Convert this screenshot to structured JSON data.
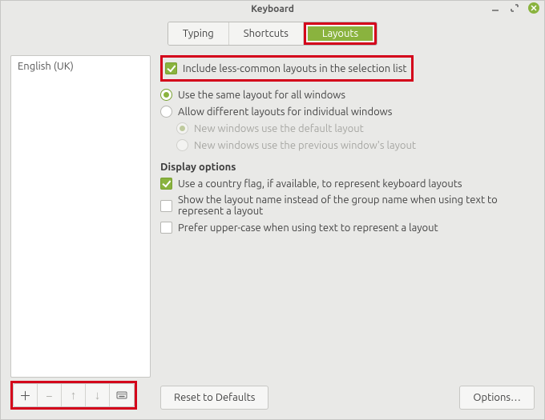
{
  "window": {
    "title": "Keyboard"
  },
  "tabs": {
    "typing": "Typing",
    "shortcuts": "Shortcuts",
    "layouts": "Layouts",
    "active": "layouts"
  },
  "layout_list": {
    "items": [
      "English (UK)"
    ]
  },
  "options": {
    "include_less_common": "Include less-common layouts in the selection list",
    "same_layout_all": "Use the same layout for all windows",
    "different_per_window": "Allow different layouts for individual windows",
    "new_default": "New windows use the default layout",
    "new_previous": "New windows use the previous window's layout"
  },
  "display": {
    "title": "Display options",
    "country_flag": "Use a country flag, if available,  to represent keyboard layouts",
    "layout_name": "Show the layout name instead of the group name when using text to represent a layout",
    "upper_case": "Prefer upper-case when using text to represent a layout"
  },
  "buttons": {
    "reset": "Reset to Defaults",
    "options": "Options…"
  }
}
